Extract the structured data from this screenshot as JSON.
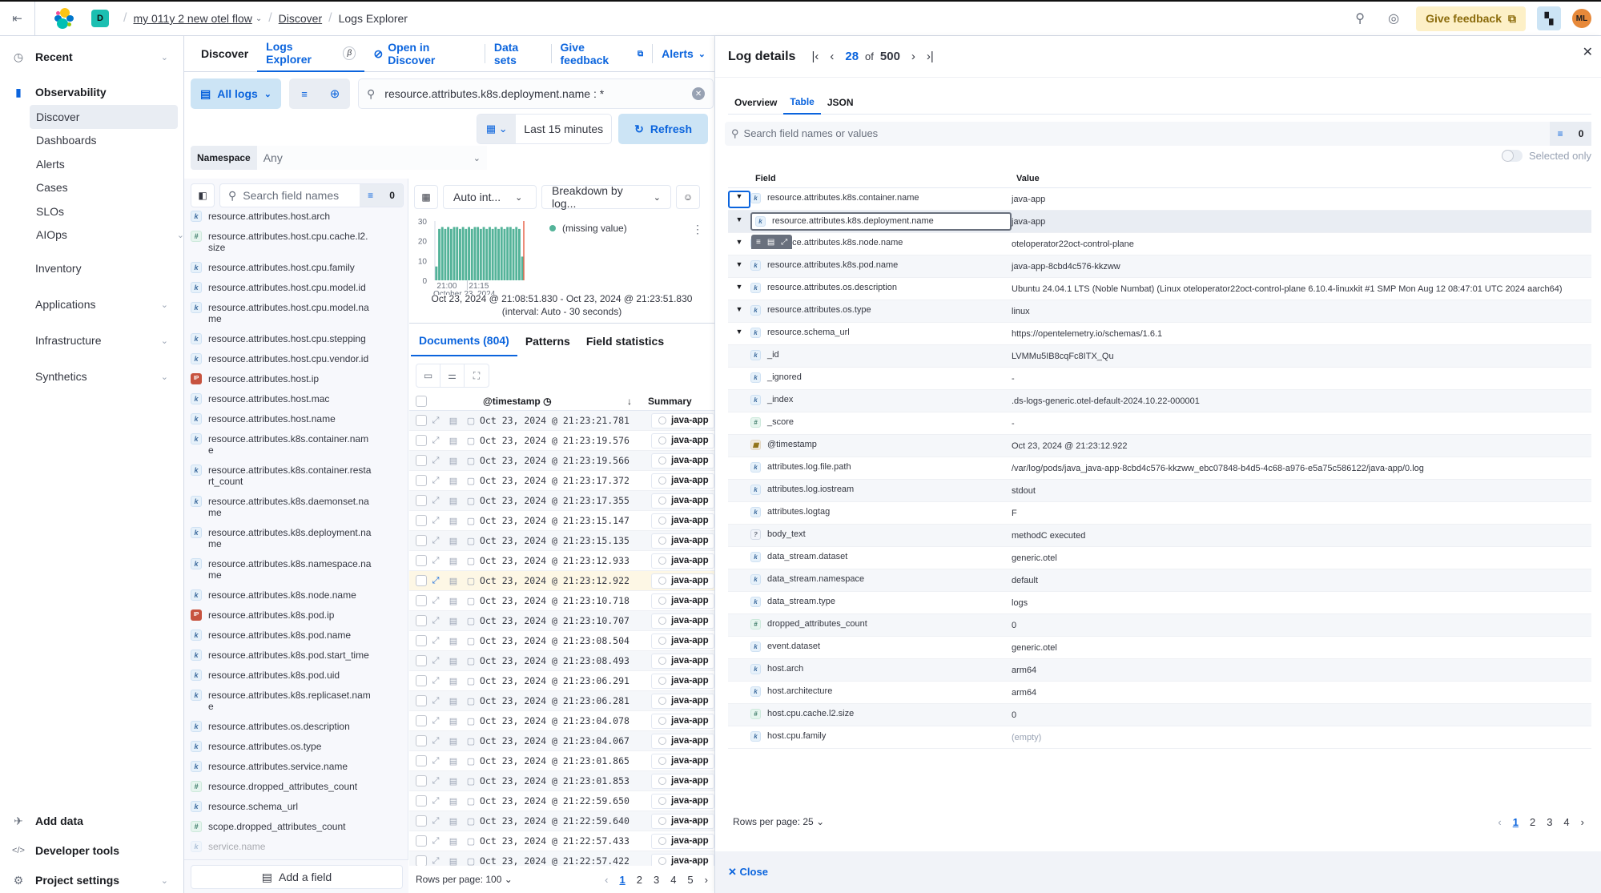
{
  "topbar": {
    "space_initial": "D",
    "breadcrumbs": [
      "my 011y 2 new otel flow",
      "Discover",
      "Logs Explorer"
    ],
    "feedback_label": "Give feedback",
    "avatar_initials": "ML"
  },
  "sidenav": {
    "recent": "Recent",
    "section": "Observability",
    "items": [
      "Discover",
      "Dashboards",
      "Alerts",
      "Cases",
      "SLOs",
      "AIOps"
    ],
    "groups": [
      "Inventory",
      "Applications",
      "Infrastructure",
      "Synthetics"
    ],
    "footer": [
      "Add data",
      "Developer tools",
      "Project settings"
    ]
  },
  "main": {
    "tabs": [
      "Discover",
      "Logs Explorer",
      "Open in Discover",
      "Data sets",
      "Give feedback",
      "Alerts"
    ],
    "beta_label": "β",
    "data_view": "All logs",
    "query": "resource.attributes.k8s.deployment.name : *",
    "time_range": "Last 15 minutes",
    "refresh_label": "Refresh",
    "namespace_label": "Namespace",
    "namespace_value": "Any"
  },
  "fieldlist": {
    "search_placeholder": "Search field names",
    "filter_count": "0",
    "add_field": "Add a field",
    "fields": [
      {
        "type": "k",
        "name": "resource.attributes.host.arch"
      },
      {
        "type": "#",
        "name": "resource.attributes.host.cpu.cache.l2.size"
      },
      {
        "type": "k",
        "name": "resource.attributes.host.cpu.family"
      },
      {
        "type": "k",
        "name": "resource.attributes.host.cpu.model.id"
      },
      {
        "type": "k",
        "name": "resource.attributes.host.cpu.model.name"
      },
      {
        "type": "k",
        "name": "resource.attributes.host.cpu.stepping"
      },
      {
        "type": "k",
        "name": "resource.attributes.host.cpu.vendor.id"
      },
      {
        "type": "ip",
        "name": "resource.attributes.host.ip"
      },
      {
        "type": "k",
        "name": "resource.attributes.host.mac"
      },
      {
        "type": "k",
        "name": "resource.attributes.host.name"
      },
      {
        "type": "k",
        "name": "resource.attributes.k8s.container.name"
      },
      {
        "type": "k",
        "name": "resource.attributes.k8s.container.restart_count"
      },
      {
        "type": "k",
        "name": "resource.attributes.k8s.daemonset.name"
      },
      {
        "type": "k",
        "name": "resource.attributes.k8s.deployment.name"
      },
      {
        "type": "k",
        "name": "resource.attributes.k8s.namespace.name"
      },
      {
        "type": "k",
        "name": "resource.attributes.k8s.node.name"
      },
      {
        "type": "ip",
        "name": "resource.attributes.k8s.pod.ip"
      },
      {
        "type": "k",
        "name": "resource.attributes.k8s.pod.name"
      },
      {
        "type": "k",
        "name": "resource.attributes.k8s.pod.start_time"
      },
      {
        "type": "k",
        "name": "resource.attributes.k8s.pod.uid"
      },
      {
        "type": "k",
        "name": "resource.attributes.k8s.replicaset.name"
      },
      {
        "type": "k",
        "name": "resource.attributes.os.description"
      },
      {
        "type": "k",
        "name": "resource.attributes.os.type"
      },
      {
        "type": "k",
        "name": "resource.attributes.service.name"
      },
      {
        "type": "#",
        "name": "resource.dropped_attributes_count"
      },
      {
        "type": "k",
        "name": "resource.schema_url"
      },
      {
        "type": "#",
        "name": "scope.dropped_attributes_count"
      },
      {
        "type": "k",
        "name": "service.name"
      }
    ]
  },
  "histogram": {
    "interval_label": "Auto int...",
    "breakdown_label": "Breakdown by log...",
    "legend": "(missing value)",
    "range": "Oct 23, 2024 @ 21:08:51.830 - Oct 23, 2024 @ 21:23:51.830",
    "interval_note": "(interval: Auto - 30 seconds)"
  },
  "chart_data": {
    "type": "bar",
    "title": "",
    "xlabel": "October 23, 2024",
    "ylabel": "",
    "ylim": [
      0,
      30
    ],
    "yticks": [
      0,
      10,
      20,
      30
    ],
    "xticks": [
      "21:00",
      "21:15"
    ],
    "series": [
      {
        "name": "(missing value)",
        "color": "#54b399",
        "values": [
          7,
          26,
          27,
          26,
          27,
          26,
          27,
          27,
          26,
          27,
          26,
          27,
          26,
          27,
          27,
          26,
          27,
          26,
          27,
          26,
          27,
          26,
          27,
          26,
          27,
          27,
          26,
          27,
          26,
          12
        ]
      }
    ],
    "legend": "top-right"
  },
  "documents": {
    "tabs": [
      "Documents (804)",
      "Patterns",
      "Field statistics"
    ],
    "col_timestamp": "@timestamp",
    "col_summary": "Summary",
    "rows": [
      {
        "ts": "Oct 23, 2024 @ 21:23:21.781",
        "summary": "java-app"
      },
      {
        "ts": "Oct 23, 2024 @ 21:23:19.576",
        "summary": "java-app"
      },
      {
        "ts": "Oct 23, 2024 @ 21:23:19.566",
        "summary": "java-app"
      },
      {
        "ts": "Oct 23, 2024 @ 21:23:17.372",
        "summary": "java-app"
      },
      {
        "ts": "Oct 23, 2024 @ 21:23:17.355",
        "summary": "java-app"
      },
      {
        "ts": "Oct 23, 2024 @ 21:23:15.147",
        "summary": "java-app"
      },
      {
        "ts": "Oct 23, 2024 @ 21:23:15.135",
        "summary": "java-app"
      },
      {
        "ts": "Oct 23, 2024 @ 21:23:12.933",
        "summary": "java-app"
      },
      {
        "ts": "Oct 23, 2024 @ 21:23:12.922",
        "summary": "java-app",
        "highlight": true
      },
      {
        "ts": "Oct 23, 2024 @ 21:23:10.718",
        "summary": "java-app"
      },
      {
        "ts": "Oct 23, 2024 @ 21:23:10.707",
        "summary": "java-app"
      },
      {
        "ts": "Oct 23, 2024 @ 21:23:08.504",
        "summary": "java-app"
      },
      {
        "ts": "Oct 23, 2024 @ 21:23:08.493",
        "summary": "java-app"
      },
      {
        "ts": "Oct 23, 2024 @ 21:23:06.291",
        "summary": "java-app"
      },
      {
        "ts": "Oct 23, 2024 @ 21:23:06.281",
        "summary": "java-app"
      },
      {
        "ts": "Oct 23, 2024 @ 21:23:04.078",
        "summary": "java-app"
      },
      {
        "ts": "Oct 23, 2024 @ 21:23:04.067",
        "summary": "java-app"
      },
      {
        "ts": "Oct 23, 2024 @ 21:23:01.865",
        "summary": "java-app"
      },
      {
        "ts": "Oct 23, 2024 @ 21:23:01.853",
        "summary": "java-app"
      },
      {
        "ts": "Oct 23, 2024 @ 21:22:59.650",
        "summary": "java-app"
      },
      {
        "ts": "Oct 23, 2024 @ 21:22:59.640",
        "summary": "java-app"
      },
      {
        "ts": "Oct 23, 2024 @ 21:22:57.433",
        "summary": "java-app"
      },
      {
        "ts": "Oct 23, 2024 @ 21:22:57.422",
        "summary": "java-app"
      }
    ],
    "rows_per_page": "Rows per page: 100",
    "pages": [
      "1",
      "2",
      "3",
      "4",
      "5"
    ],
    "current_page": "1"
  },
  "log_details": {
    "title": "Log details",
    "current": "28",
    "of_label": "of",
    "total": "500",
    "tabs": [
      "Overview",
      "Table",
      "JSON"
    ],
    "active_tab": "Table",
    "search_placeholder": "Search field names or values",
    "filter_count": "0",
    "selected_only": "Selected only",
    "col_field": "Field",
    "col_value": "Value",
    "rows": [
      {
        "pinned": true,
        "type": "k",
        "field": "resource.attributes.k8s.container.name",
        "value": "java-app"
      },
      {
        "pinned": true,
        "type": "k",
        "field": "resource.attributes.k8s.deployment.name",
        "value": "java-app",
        "selected": true
      },
      {
        "pinned": true,
        "type": "k",
        "field": "resource.attributes.k8s.node.name",
        "value": "oteloperator22oct-control-plane"
      },
      {
        "pinned": true,
        "type": "k",
        "field": "resource.attributes.k8s.pod.name",
        "value": "java-app-8cbd4c576-kkzww"
      },
      {
        "pinned": true,
        "type": "k",
        "field": "resource.attributes.os.description",
        "value": "Ubuntu 24.04.1 LTS (Noble Numbat) (Linux oteloperator22oct-control-plane 6.10.4-linuxkit #1 SMP Mon Aug 12 08:47:01 UTC 2024 aarch64)"
      },
      {
        "pinned": true,
        "type": "k",
        "field": "resource.attributes.os.type",
        "value": "linux"
      },
      {
        "pinned": true,
        "type": "k",
        "field": "resource.schema_url",
        "value": "https://opentelemetry.io/schemas/1.6.1"
      },
      {
        "pinned": false,
        "type": "k",
        "field": "_id",
        "value": "LVMMu5IB8cqFc8ITX_Qu"
      },
      {
        "pinned": false,
        "type": "k",
        "field": "_ignored",
        "value": "-"
      },
      {
        "pinned": false,
        "type": "k",
        "field": "_index",
        "value": ".ds-logs-generic.otel-default-2024.10.22-000001"
      },
      {
        "pinned": false,
        "type": "#",
        "field": "_score",
        "value": "-"
      },
      {
        "pinned": false,
        "type": "date",
        "field": "@timestamp",
        "value": "Oct 23, 2024 @ 21:23:12.922"
      },
      {
        "pinned": false,
        "type": "k",
        "field": "attributes.log.file.path",
        "value": "/var/log/pods/java_java-app-8cbd4c576-kkzww_ebc07848-b4d5-4c68-a976-e5a75c586122/java-app/0.log"
      },
      {
        "pinned": false,
        "type": "k",
        "field": "attributes.log.iostream",
        "value": "stdout"
      },
      {
        "pinned": false,
        "type": "k",
        "field": "attributes.logtag",
        "value": "F"
      },
      {
        "pinned": false,
        "type": "?",
        "field": "body_text",
        "value": "methodC executed"
      },
      {
        "pinned": false,
        "type": "k",
        "field": "data_stream.dataset",
        "value": "generic.otel"
      },
      {
        "pinned": false,
        "type": "k",
        "field": "data_stream.namespace",
        "value": "default"
      },
      {
        "pinned": false,
        "type": "k",
        "field": "data_stream.type",
        "value": "logs"
      },
      {
        "pinned": false,
        "type": "#",
        "field": "dropped_attributes_count",
        "value": "0"
      },
      {
        "pinned": false,
        "type": "k",
        "field": "event.dataset",
        "value": "generic.otel"
      },
      {
        "pinned": false,
        "type": "k",
        "field": "host.arch",
        "value": "arm64"
      },
      {
        "pinned": false,
        "type": "k",
        "field": "host.architecture",
        "value": "arm64"
      },
      {
        "pinned": false,
        "type": "#",
        "field": "host.cpu.cache.l2.size",
        "value": "0"
      },
      {
        "pinned": false,
        "type": "k",
        "field": "host.cpu.family",
        "value": "(empty)",
        "empty": true
      }
    ],
    "rows_per_page": "Rows per page: 25",
    "pages": [
      "1",
      "2",
      "3",
      "4"
    ],
    "current_page": "1",
    "close_label": "Close"
  }
}
